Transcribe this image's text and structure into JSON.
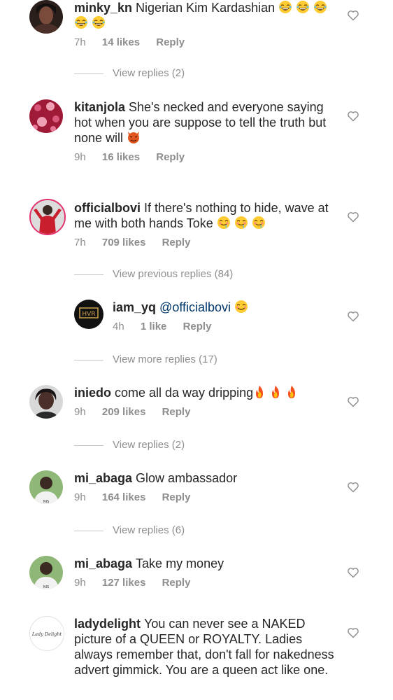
{
  "comments": [
    {
      "user": "minky_kn",
      "text": "Nigerian Kim Kardashian",
      "emoji": [
        "laugh",
        "laugh",
        "laugh",
        "laugh",
        "laugh"
      ],
      "time": "7h",
      "likes": "14 likes",
      "reply": "Reply",
      "view": "View replies (2)"
    },
    {
      "user": "kitanjola",
      "text": "She's necked and everyone saying hot when you are suppose to tell the truth but none will",
      "emoji": [
        "devil"
      ],
      "time": "9h",
      "likes": "16 likes",
      "reply": "Reply"
    },
    {
      "user": "officialbovi",
      "text": "If there's nothing to hide, wave at me with both hands Toke",
      "emoji": [
        "drool",
        "drool",
        "drool"
      ],
      "time": "7h",
      "likes": "709 likes",
      "reply": "Reply",
      "view": "View previous replies (84)"
    },
    {
      "user": "iam_yq",
      "text": "@officialbovi",
      "emoji": [
        "smile"
      ],
      "time": "4h",
      "likes": "1 like",
      "reply": "Reply",
      "view": "View more replies (17)"
    },
    {
      "user": "iniedo",
      "text": "come all da way dripping",
      "emoji": [
        "fire",
        "fire",
        "fire"
      ],
      "time": "9h",
      "likes": "209 likes",
      "reply": "Reply",
      "view": "View replies (2)"
    },
    {
      "user": "mi_abaga",
      "text": "Glow ambassador",
      "emoji": [],
      "time": "9h",
      "likes": "164 likes",
      "reply": "Reply",
      "view": "View replies (6)"
    },
    {
      "user": "mi_abaga",
      "text": "Take my money",
      "emoji": [],
      "time": "9h",
      "likes": "127 likes",
      "reply": "Reply"
    },
    {
      "user": "ladydelight",
      "text": "You can never see a NAKED picture of a QUEEN or ROYALTY. Ladies always remember that, don't fall for nakedness advert gimmick. You are a queen act like one.",
      "emoji": [],
      "avatar_text": "Lady Delight"
    }
  ],
  "colors": {
    "text": "#262626",
    "muted": "#8e8e8e",
    "line": "#c7c7c7"
  }
}
